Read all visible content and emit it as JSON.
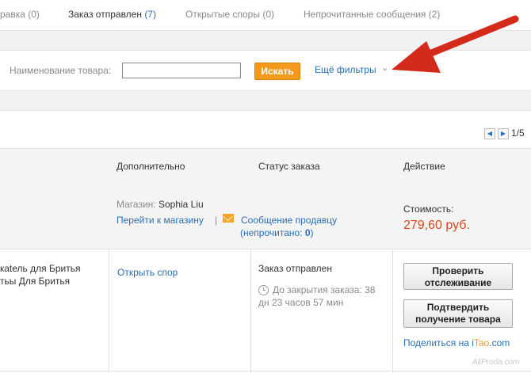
{
  "tabs": [
    {
      "label": "равка",
      "count": "(0)"
    },
    {
      "label": "Заказ отправлен",
      "count": "(7)"
    },
    {
      "label": "Открытые споры",
      "count": "(0)"
    },
    {
      "label": "Непрочитанные сообщения",
      "count": "(2)"
    }
  ],
  "filter": {
    "label": "Наименование товара:",
    "input_value": "",
    "search_button": "Искать",
    "more_filters": "Ещё фильтры"
  },
  "pager": {
    "text": "1/5"
  },
  "table": {
    "headers": [
      "Дополнительно",
      "Статус заказа",
      "Действие"
    ]
  },
  "store": {
    "label": "Магазин:",
    "name": "Sophia Liu",
    "go_to_store": "Перейти к магазину",
    "separator": "|",
    "message_seller": "Сообщение продавцу",
    "unread_prefix": "(непрочитано: ",
    "unread_count": "0",
    "unread_suffix": ")",
    "price_label": "Стоимость:",
    "price": "279,60 руб."
  },
  "order": {
    "title_line1": "кatель для Бритья",
    "title_line2": "тьы Для Бритья",
    "open_dispute": "Открыть спор",
    "status": "Заказ отправлен",
    "countdown_line1": "До закрытия заказа: 38",
    "countdown_line2": "дн 23 часов 57 мин",
    "btn_tracking_line1": "Проверить",
    "btn_tracking_line2": "отслеживание",
    "btn_confirm_line1": "Подтвердить",
    "btn_confirm_line2": "получение товара",
    "share_prefix": "Поделиться на ",
    "share_i": "i",
    "share_tao": "Tao",
    "share_com": ".com"
  },
  "watermark": "AliProda.com",
  "icons": {
    "arrow": "red-arrow-annotation",
    "chevron": "chevron-down-icon",
    "envelope": "envelope-icon",
    "clock": "clock-icon"
  },
  "colors": {
    "link": "#2a6fb5",
    "accent": "#f39a1d",
    "price": "#d9461c",
    "arrow": "#d42a1c"
  }
}
